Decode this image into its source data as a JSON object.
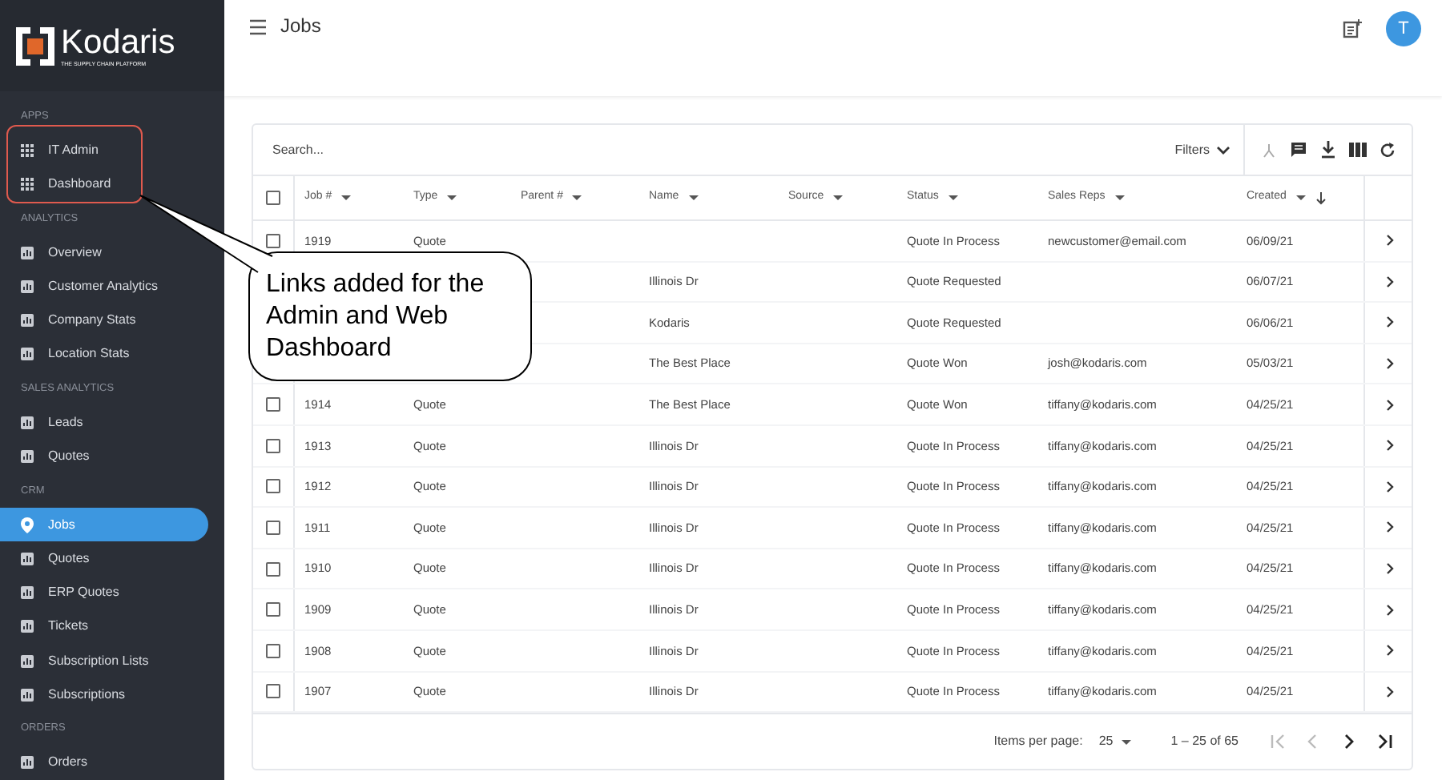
{
  "sidebar": {
    "logo": {
      "name": "Kodaris",
      "tagline": "THE SUPPLY CHAIN PLATFORM"
    },
    "sections": [
      {
        "title": "APPS",
        "kind": "apps",
        "items": [
          {
            "label": "IT Admin",
            "selected": false
          },
          {
            "label": "Dashboard",
            "selected": false
          }
        ]
      },
      {
        "title": "ANALYTICS",
        "kind": "links",
        "items": [
          {
            "label": "Overview",
            "selected": false
          },
          {
            "label": "Customer Analytics",
            "selected": false
          },
          {
            "label": "Company Stats",
            "selected": false
          },
          {
            "label": "Location Stats",
            "selected": false
          }
        ]
      },
      {
        "title": "SALES ANALYTICS",
        "kind": "links",
        "items": [
          {
            "label": "Leads",
            "selected": false
          },
          {
            "label": "Quotes",
            "selected": false
          }
        ]
      },
      {
        "title": "CRM",
        "kind": "links",
        "items": [
          {
            "label": "Jobs",
            "selected": true
          },
          {
            "label": "Quotes",
            "selected": false
          },
          {
            "label": "ERP Quotes",
            "selected": false
          },
          {
            "label": "Tickets",
            "selected": false
          },
          {
            "label": "Subscription Lists",
            "selected": false
          },
          {
            "label": "Subscriptions",
            "selected": false
          }
        ]
      },
      {
        "title": "ORDERS",
        "kind": "links",
        "items": [
          {
            "label": "Orders",
            "selected": false
          }
        ]
      }
    ]
  },
  "header": {
    "title": "Jobs",
    "avatar": "T"
  },
  "toolbar": {
    "search_placeholder": "Search...",
    "filters": "Filters"
  },
  "table": {
    "select_all": {
      "checked": false
    },
    "columns": [
      {
        "label": "Job #",
        "sorted": false
      },
      {
        "label": "Type",
        "sorted": false
      },
      {
        "label": "Parent #",
        "sorted": false
      },
      {
        "label": "Name",
        "sorted": false
      },
      {
        "label": "Source",
        "sorted": false
      },
      {
        "label": "Status",
        "sorted": false
      },
      {
        "label": "Sales Reps",
        "sorted": false
      },
      {
        "label": "Created",
        "sorted": true
      }
    ],
    "rows": [
      {
        "checked": false,
        "job": "1919",
        "type": "Quote",
        "status": "Quote In Process",
        "sales_rep": "newcustomer@email.com",
        "created": "06/09/21"
      },
      {
        "name": "Illinois Dr",
        "status": "Quote Requested",
        "created": "06/07/21"
      },
      {
        "name": "Kodaris",
        "status": "Quote Requested",
        "created": "06/06/21"
      },
      {
        "name": "The Best Place",
        "status": "Quote Won",
        "sales_rep": "josh@kodaris.com",
        "created": "05/03/21"
      },
      {
        "checked": false,
        "job": "1914",
        "type": "Quote",
        "name": "The Best Place",
        "status": "Quote Won",
        "sales_rep": "tiffany@kodaris.com",
        "created": "04/25/21"
      },
      {
        "checked": false,
        "job": "1913",
        "type": "Quote",
        "name": "Illinois Dr",
        "status": "Quote In Process",
        "sales_rep": "tiffany@kodaris.com",
        "created": "04/25/21"
      },
      {
        "checked": false,
        "job": "1912",
        "type": "Quote",
        "name": "Illinois Dr",
        "status": "Quote In Process",
        "sales_rep": "tiffany@kodaris.com",
        "created": "04/25/21"
      },
      {
        "checked": false,
        "job": "1911",
        "type": "Quote",
        "name": "Illinois Dr",
        "status": "Quote In Process",
        "sales_rep": "tiffany@kodaris.com",
        "created": "04/25/21"
      },
      {
        "checked": false,
        "job": "1910",
        "type": "Quote",
        "name": "Illinois Dr",
        "status": "Quote In Process",
        "sales_rep": "tiffany@kodaris.com",
        "created": "04/25/21"
      },
      {
        "checked": false,
        "job": "1909",
        "type": "Quote",
        "name": "Illinois Dr",
        "status": "Quote In Process",
        "sales_rep": "tiffany@kodaris.com",
        "created": "04/25/21"
      },
      {
        "checked": false,
        "job": "1908",
        "type": "Quote",
        "name": "Illinois Dr",
        "status": "Quote In Process",
        "sales_rep": "tiffany@kodaris.com",
        "created": "04/25/21"
      },
      {
        "checked": false,
        "job": "1907",
        "type": "Quote",
        "name": "Illinois Dr",
        "status": "Quote In Process",
        "sales_rep": "tiffany@kodaris.com",
        "created": "04/25/21"
      }
    ]
  },
  "paginator": {
    "label": "Items per page:",
    "page_size": "25",
    "range": "1 – 25 of 65",
    "nav": [
      {
        "kind": "first",
        "disabled": true
      },
      {
        "kind": "prev",
        "disabled": true
      },
      {
        "kind": "next",
        "disabled": false
      },
      {
        "kind": "last",
        "disabled": false
      }
    ]
  },
  "callout": {
    "text": "Links added for the Admin and Web Dashboard"
  }
}
